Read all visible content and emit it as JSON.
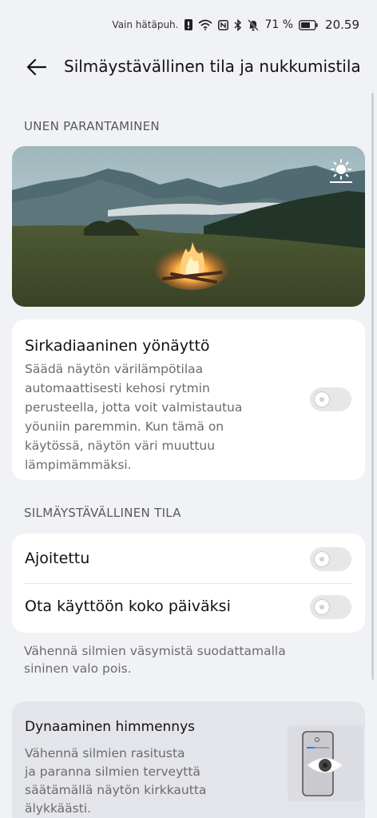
{
  "status_bar": {
    "emergency_text": "Vain hätäpuh.",
    "battery_percent": "71 %",
    "time": "20.59",
    "icons": [
      "alert-icon",
      "wifi-icon",
      "nfc-icon",
      "bluetooth-icon",
      "mute-icon",
      "battery-icon"
    ]
  },
  "header": {
    "title": "Silmäystävällinen tila ja nukkumistila",
    "back_icon": "back-arrow-icon"
  },
  "sleep_section": {
    "label": "UNEN PARANTAMINEN",
    "banner_icon": "brightness-icon"
  },
  "circadian": {
    "title": "Sirkadiaaninen yönäyttö",
    "description_lines": [
      "Säädä näytön värilämpötilaa",
      "automaattisesti kehosi rytmin",
      "perusteella, jotta voit valmistautua",
      "yöuniin paremmin. Kun tämä on",
      "käytössä, näytön väri muuttuu",
      "lämpimämmäksi."
    ],
    "enabled": false
  },
  "eye_section": {
    "label": "SILMÄYSTÄVÄLLINEN TILA",
    "rows": [
      {
        "label": "Ajoitettu",
        "enabled": false
      },
      {
        "label": "Ota käyttöön koko päiväksi",
        "enabled": false
      }
    ],
    "note_lines": [
      "Vähennä silmien väsymistä suodattamalla",
      "sininen valo pois."
    ]
  },
  "dynamic_dimming": {
    "title": "Dynaaminen himmennys",
    "description_lines": [
      "Vähennä silmien rasitusta",
      "ja paranna silmien terveyttä",
      "säätämällä näytön kirkkautta",
      "älykkäästi."
    ],
    "illustration_icon": "phone-eye-icon"
  },
  "colors": {
    "background": "#f1f2f6",
    "card": "#ffffff",
    "toggle_off": "#e7e7ea",
    "secondary_text": "#6b6b6b"
  }
}
